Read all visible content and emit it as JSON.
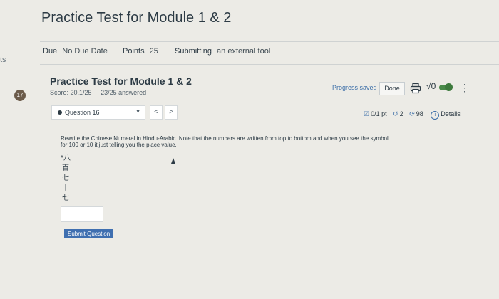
{
  "left_strip": {
    "text": "ts"
  },
  "header": {
    "title": "Practice Test for Module 1 & 2"
  },
  "meta": {
    "due_label": "Due",
    "due_value": "No Due Date",
    "points_label": "Points",
    "points_value": "25",
    "submitting_label": "Submitting",
    "submitting_value": "an external tool"
  },
  "badge": {
    "count": "17"
  },
  "quiz": {
    "title": "Practice Test for Module 1 & 2",
    "score": "Score: 20.1/25",
    "answered": "23/25 answered",
    "progress_status": "Progress saved",
    "done_label": "Done"
  },
  "question_nav": {
    "selected": "Question 16",
    "prev": "<",
    "next": ">"
  },
  "question_meta": {
    "points": "0/1 pt",
    "retries": "2",
    "attempts": "98",
    "details": "Details"
  },
  "question": {
    "text": "Rewrite the Chinese Numeral in Hindu-Arabic. Note that the numbers are written from top to bottom and when you see the symbol for 100 or 10 it just telling you the place value.",
    "numeral_lines": [
      "*八",
      "百",
      "七",
      "十",
      "七"
    ]
  },
  "answer": {
    "value": ""
  },
  "submit": {
    "label": "Submit Question"
  },
  "icons": {
    "print": "printer-icon",
    "sqrt": "sqrt-icon",
    "toggle": "toggle-icon",
    "kebab": "kebab-menu-icon",
    "points": "checkbox-icon",
    "retry": "retry-icon",
    "attempts": "refresh-icon",
    "details": "info-icon"
  },
  "colors": {
    "background": "#ecebe6",
    "accent": "#3f6fb0",
    "toggle": "#4a8a4a",
    "badge": "#6b5b4a"
  }
}
